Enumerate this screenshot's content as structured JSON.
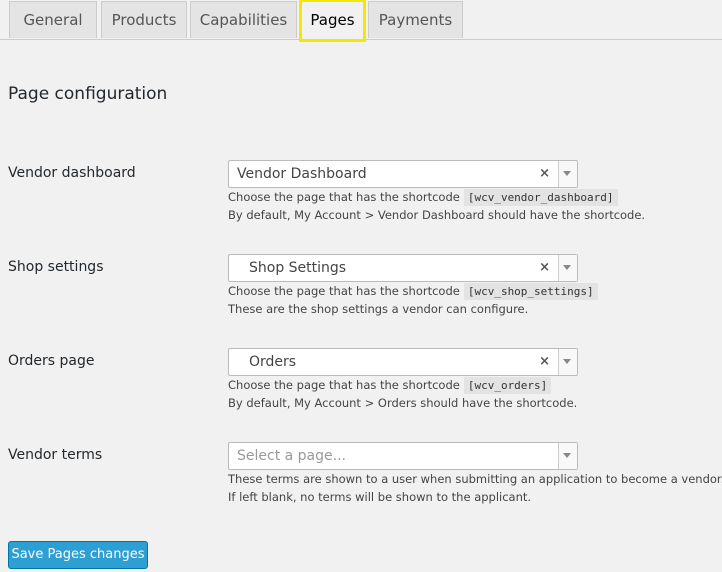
{
  "tabs": [
    {
      "label": "General"
    },
    {
      "label": "Products"
    },
    {
      "label": "Capabilities"
    },
    {
      "label": "Pages"
    },
    {
      "label": "Payments"
    }
  ],
  "section_title": "Page configuration",
  "rows": [
    {
      "label": "Vendor dashboard",
      "selected": "Vendor Dashboard",
      "desc_prefix": "Choose the page that has the shortcode",
      "shortcode": "[wcv_vendor_dashboard]",
      "desc_line2": "By default, My Account > Vendor Dashboard should have the shortcode."
    },
    {
      "label": "Shop settings",
      "selected": "Shop Settings",
      "desc_prefix": "Choose the page that has the shortcode",
      "shortcode": "[wcv_shop_settings]",
      "desc_line2": "These are the shop settings a vendor can configure."
    },
    {
      "label": "Orders page",
      "selected": "Orders",
      "desc_prefix": "Choose the page that has the shortcode",
      "shortcode": "[wcv_orders]",
      "desc_line2": "By default, My Account > Orders should have the shortcode."
    },
    {
      "label": "Vendor terms",
      "placeholder": "Select a page...",
      "desc_line1": "These terms are shown to a user when submitting an application to become a vendor.",
      "desc_line2": "If left blank, no terms will be shown to the applicant."
    }
  ],
  "clear_glyph": "×",
  "save_label": "Save Pages changes",
  "colors": {
    "tab_highlight": "#f5e800",
    "primary_button": "#2e9fd2"
  }
}
